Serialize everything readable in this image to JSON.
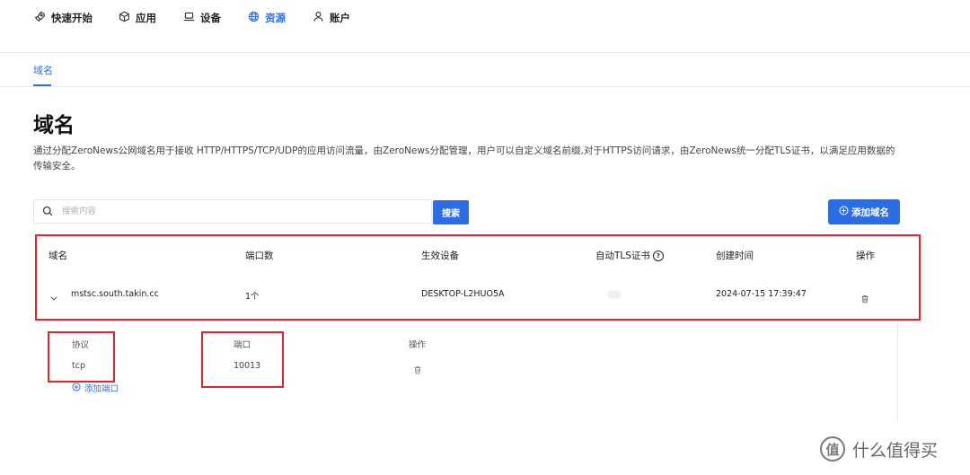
{
  "nav": {
    "items": [
      {
        "label": "快速开始",
        "icon": "rocket-icon"
      },
      {
        "label": "应用",
        "icon": "cube-icon"
      },
      {
        "label": "设备",
        "icon": "laptop-icon"
      },
      {
        "label": "资源",
        "icon": "globe-icon",
        "active": true
      },
      {
        "label": "账户",
        "icon": "user-icon"
      }
    ],
    "active_color": "#2f6fe4"
  },
  "subtabs": [
    "域名"
  ],
  "page": {
    "title": "域名",
    "description": "通过分配ZeroNews公网域名用于接收 HTTP/HTTPS/TCP/UDP的应用访问流量，由ZeroNews分配管理，用户可以自定义域名前缀,对于HTTPS访问请求，由ZeroNews统一分配TLS证书，以满足应用数据的传输安全。"
  },
  "search": {
    "placeholder": "搜索内容",
    "value": "",
    "button_label": "搜索"
  },
  "add_domain_label": "添加域名",
  "table": {
    "columns": [
      "域名",
      "端口数",
      "生效设备",
      "自动TLS证书",
      "创建时间",
      "操作"
    ],
    "rows": [
      {
        "domain": "mstsc.south.takin.cc",
        "ports": "1个",
        "device": "DESKTOP-L2HUO5A",
        "auto_tls": false,
        "created": "2024-07-15 17:39:47"
      }
    ]
  },
  "expanded": {
    "columns": [
      "协议",
      "端口",
      "操作"
    ],
    "rows": [
      {
        "protocol": "tcp",
        "port": "10013"
      }
    ],
    "add_port_label": "添加端口"
  },
  "watermark": {
    "logo": "值",
    "text": "什么值得买"
  },
  "colors": {
    "primary": "#2b6de5",
    "highlight": "#e0252d"
  }
}
